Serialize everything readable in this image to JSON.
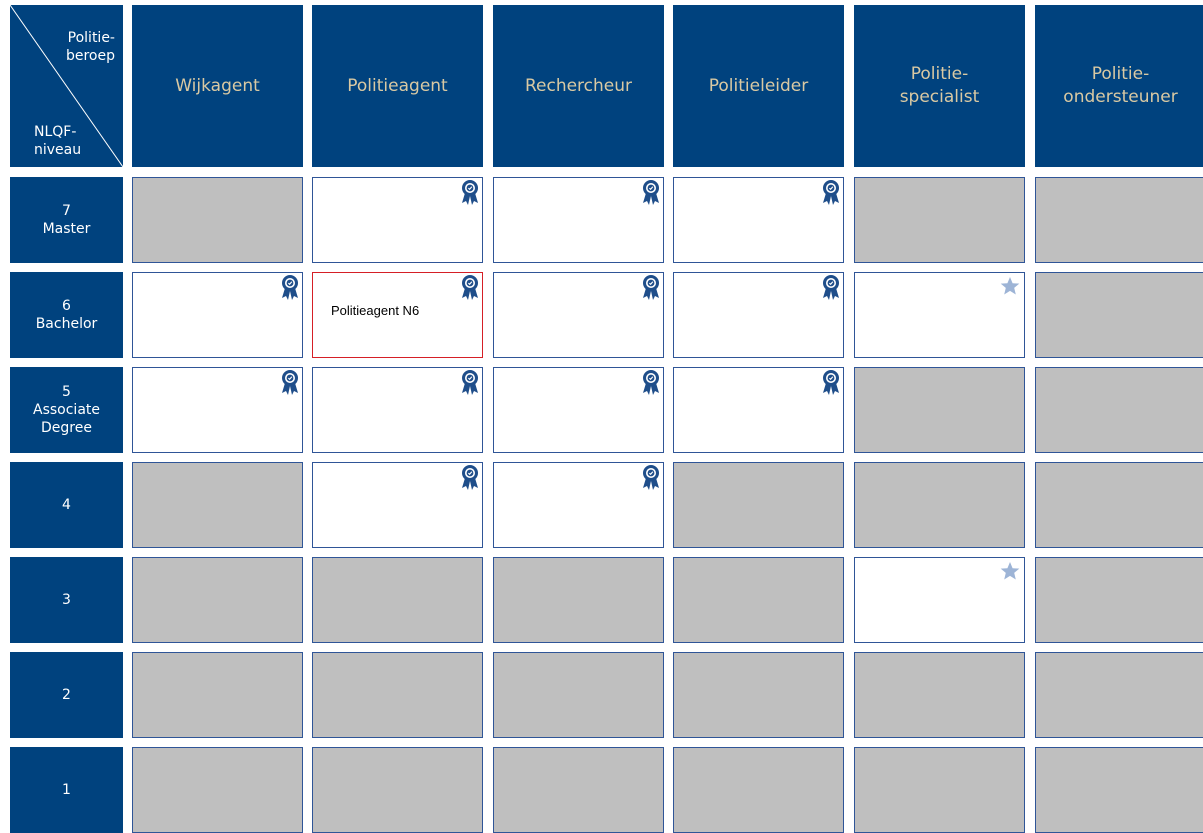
{
  "corner": {
    "beroep_label": "Politie-\nberoep",
    "niveau_label": "NLQF-\nniveau"
  },
  "columns": [
    {
      "label": "Wijkagent"
    },
    {
      "label": "Politieagent"
    },
    {
      "label": "Rechercheur"
    },
    {
      "label": "Politieleider"
    },
    {
      "label": "Politie-\nspecialist"
    },
    {
      "label": "Politie-\nondersteuner"
    }
  ],
  "rows": [
    {
      "label": "7\nMaster"
    },
    {
      "label": "6\nBachelor"
    },
    {
      "label": "5\nAssociate\nDegree"
    },
    {
      "label": "4"
    },
    {
      "label": "3"
    },
    {
      "label": "2"
    },
    {
      "label": "1"
    }
  ],
  "cells": [
    [
      "na",
      "badge",
      "badge",
      "badge",
      "na",
      "na"
    ],
    [
      "badge",
      "badge",
      "badge",
      "badge",
      "star",
      "na"
    ],
    [
      "badge",
      "badge",
      "badge",
      "badge",
      "na",
      "na"
    ],
    [
      "na",
      "badge",
      "badge",
      "na",
      "na",
      "na"
    ],
    [
      "na",
      "na",
      "na",
      "na",
      "star",
      "na"
    ],
    [
      "na",
      "na",
      "na",
      "na",
      "na",
      "na"
    ],
    [
      "na",
      "na",
      "na",
      "na",
      "na",
      "na"
    ]
  ],
  "selected_cell": {
    "row": 1,
    "col": 1,
    "label": "Politieagent N6"
  },
  "icons": {
    "badge": "award-ribbon-icon",
    "star": "star-icon"
  },
  "colors": {
    "header_bg": "#00427e",
    "header_text": "#d9c9a3",
    "row_header_text": "#ffffff",
    "unavailable_cell": "#bfbfbf",
    "cell_border": "#2f5597",
    "badge": "#1f4e8a",
    "star": "#9db4d6",
    "selected_border": "#d51f26"
  }
}
